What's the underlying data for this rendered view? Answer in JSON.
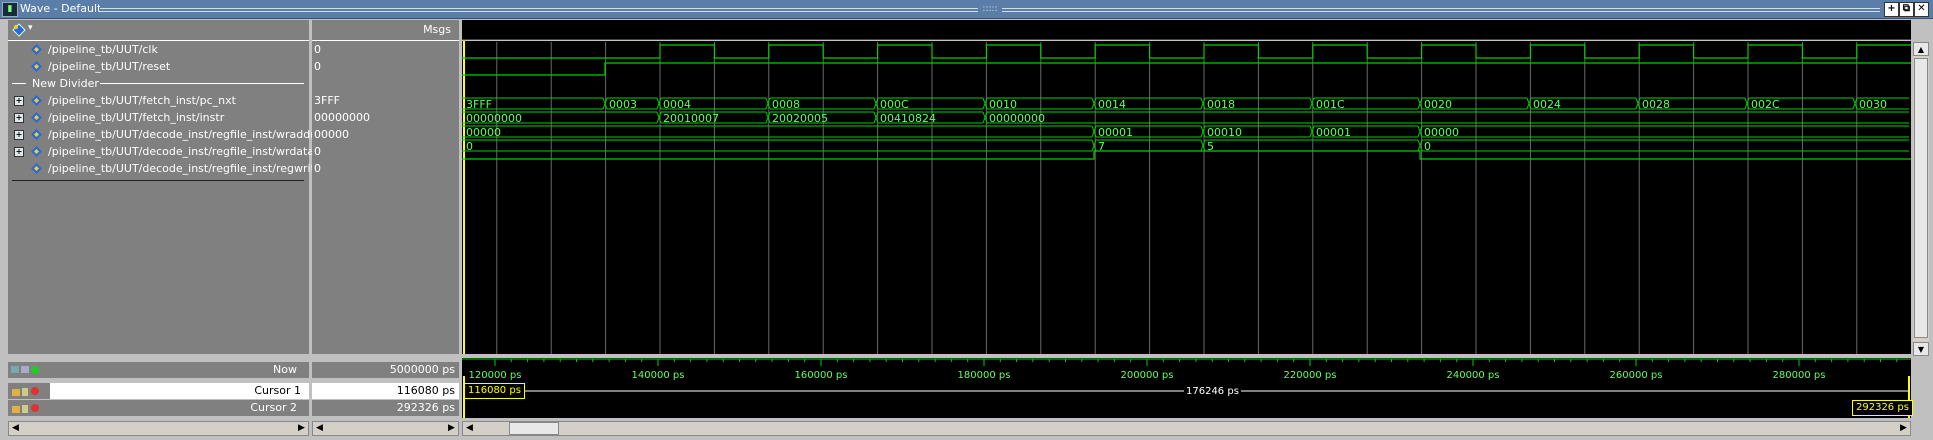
{
  "window": {
    "title": "Wave - Default",
    "grip_text": ":::::"
  },
  "toolbar": {
    "menu_arrow": "▾"
  },
  "title_buttons": [
    "+",
    "⧉",
    "✕"
  ],
  "headers": {
    "msgs": "Msgs"
  },
  "signals": [
    {
      "name": "/pipeline_tb/UUT/clk",
      "value": "0",
      "expandable": false
    },
    {
      "name": "/pipeline_tb/UUT/reset",
      "value": "0",
      "expandable": false
    },
    {
      "divider": true,
      "name": "New Divider"
    },
    {
      "name": "/pipeline_tb/UUT/fetch_inst/pc_nxt",
      "value": "3FFF",
      "expandable": true
    },
    {
      "name": "/pipeline_tb/UUT/fetch_inst/instr",
      "value": "00000000",
      "expandable": true
    },
    {
      "name": "/pipeline_tb/UUT/decode_inst/regfile_inst/wraddr",
      "value": "00000",
      "expandable": true
    },
    {
      "name": "/pipeline_tb/UUT/decode_inst/regfile_inst/wrdata",
      "value": "0",
      "expandable": true
    },
    {
      "name": "/pipeline_tb/UUT/decode_inst/regfile_inst/regwrite",
      "value": "0",
      "expandable": false
    }
  ],
  "wave_labels": {
    "pc_nxt": [
      "3FFF",
      "0003",
      "0004",
      "0008",
      "000C",
      "0010",
      "0014",
      "0018",
      "001C",
      "0020",
      "0024",
      "0028",
      "002C",
      "0030"
    ],
    "instr": [
      "00000000",
      "20010007",
      "20020005",
      "00410824",
      "00000000"
    ],
    "wraddr": [
      "00000",
      "00001",
      "00010",
      "00001",
      "00000"
    ],
    "wrdata": [
      "0",
      "7",
      "5",
      "0"
    ]
  },
  "cursor_rows": {
    "now_label": "Now",
    "now_value": "5000000 ps",
    "cursor1_label": "Cursor 1",
    "cursor1_value": "116080 ps",
    "cursor2_label": "Cursor 2",
    "cursor2_value": "292326 ps"
  },
  "timeline": {
    "ticks": [
      "120000 ps",
      "140000 ps",
      "160000 ps",
      "180000 ps",
      "200000 ps",
      "220000 ps",
      "240000 ps",
      "260000 ps",
      "280000 ps"
    ],
    "cursor1_tag": "116080 ps",
    "cursor2_tag": "292326 ps",
    "delta_label": "176246 ps"
  },
  "scroll": {
    "left": "◀",
    "right": "▶",
    "up": "▲",
    "down": "▼"
  },
  "colors": {
    "wave": "#00d000",
    "wave_label": "#5fff5f",
    "grid": "#6a6a6a",
    "cursor": "#ffff00"
  }
}
